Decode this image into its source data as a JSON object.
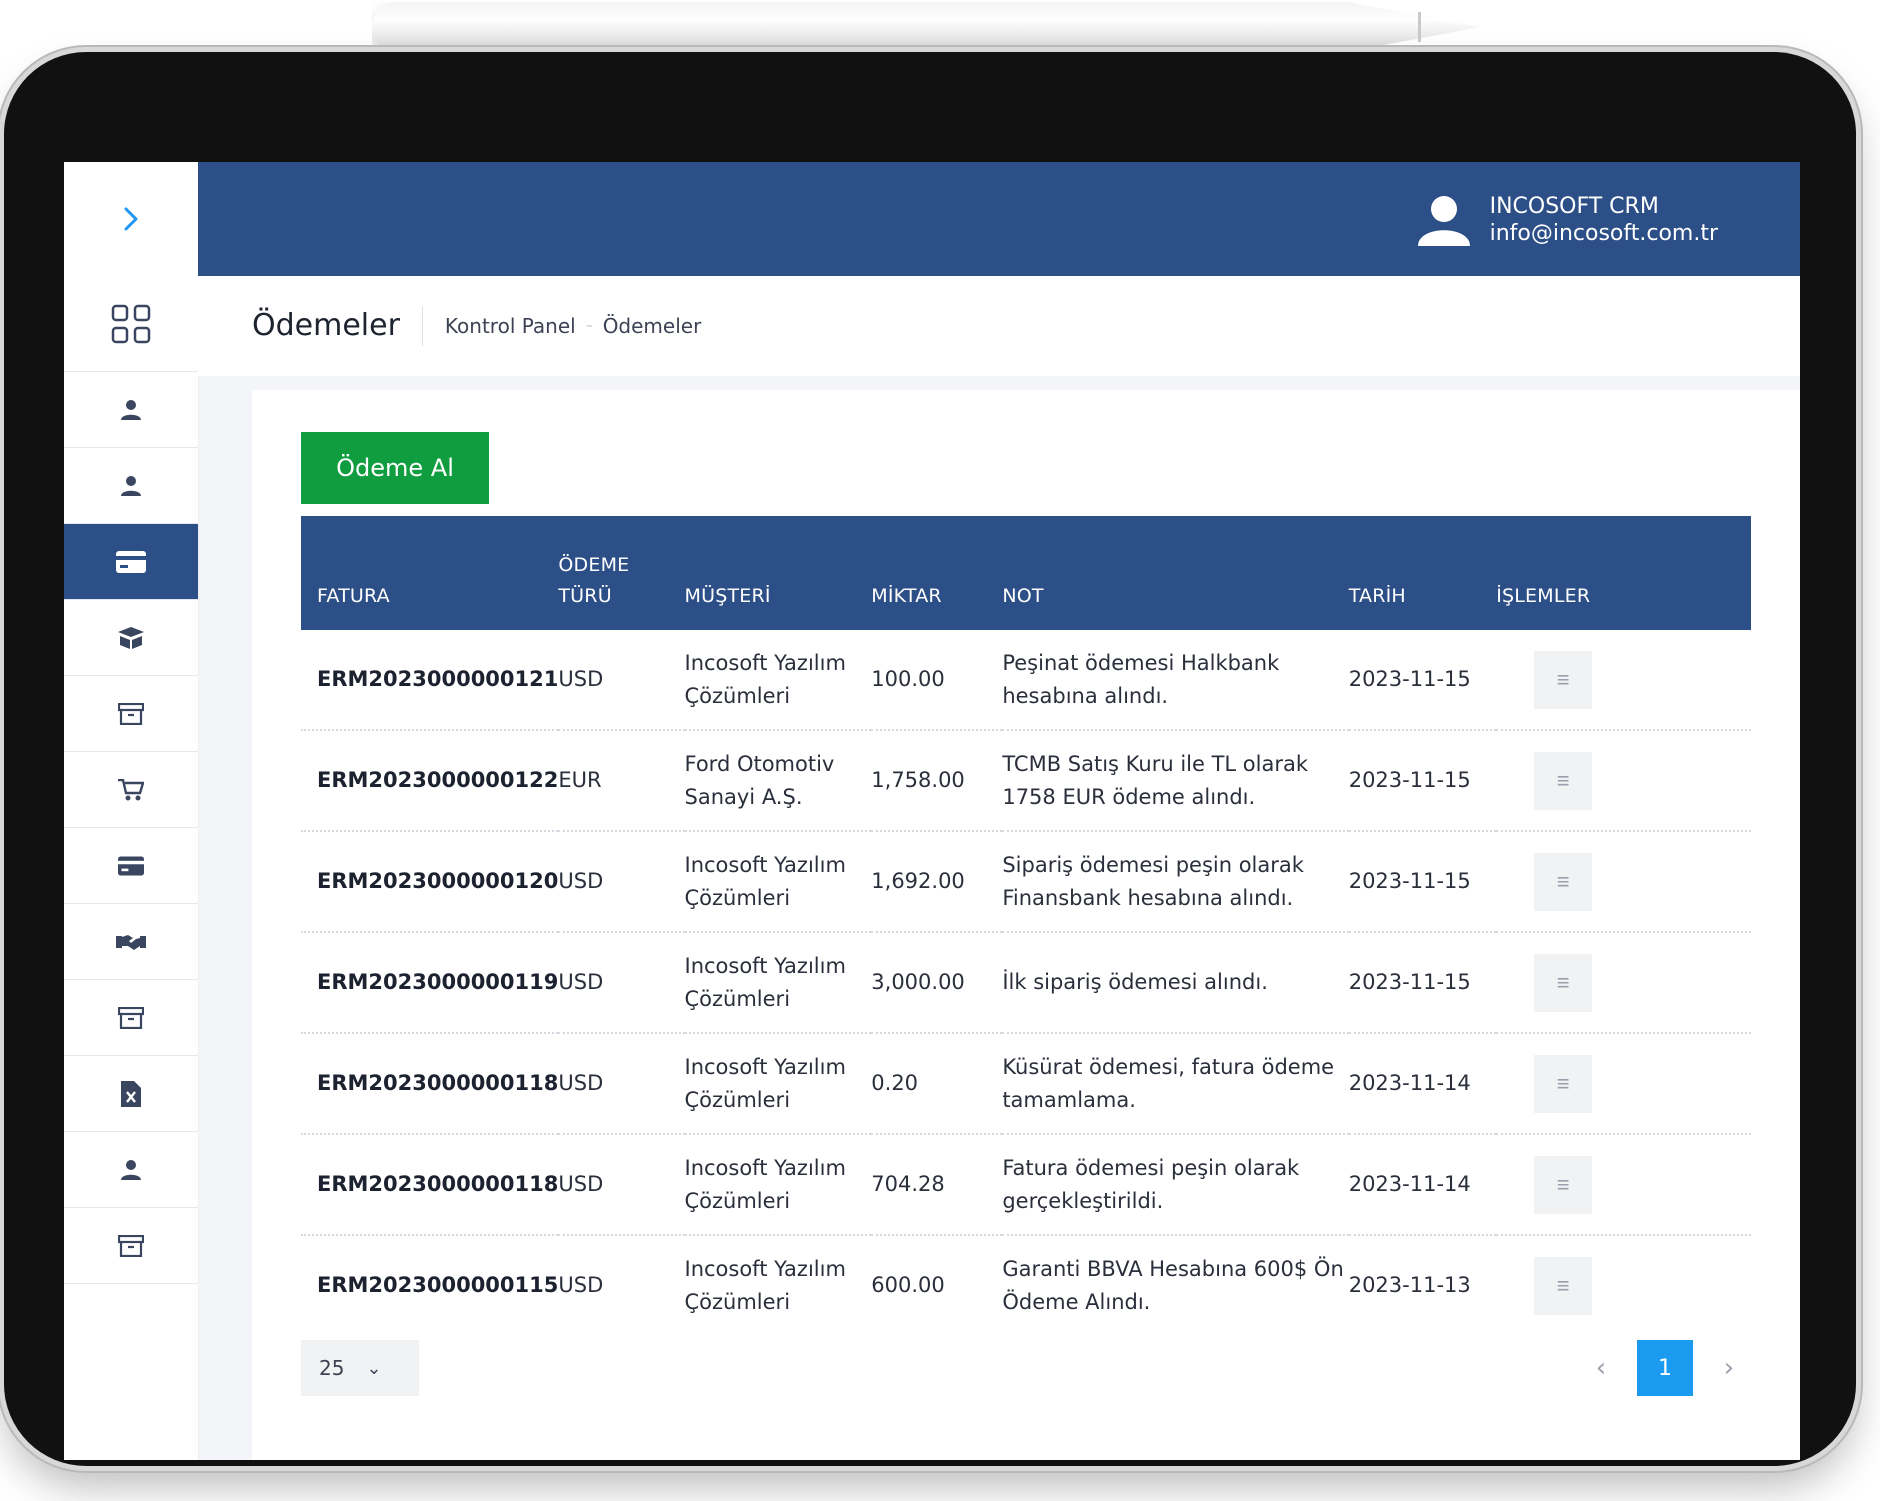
{
  "header": {
    "user_name": "INCOSOFT CRM",
    "user_email": "info@incosoft.com.tr"
  },
  "page": {
    "title": "Ödemeler",
    "breadcrumb": [
      "Kontrol Panel",
      "Ödemeler"
    ]
  },
  "actions": {
    "primary_label": "Ödeme Al"
  },
  "sidebar": {
    "items": [
      {
        "icon": "grid-icon"
      },
      {
        "icon": "user-icon"
      },
      {
        "icon": "user-icon"
      },
      {
        "icon": "credit-card-icon",
        "active": true
      },
      {
        "icon": "box-icon"
      },
      {
        "icon": "archive-icon"
      },
      {
        "icon": "cart-icon"
      },
      {
        "icon": "credit-card-icon"
      },
      {
        "icon": "handshake-icon"
      },
      {
        "icon": "archive-icon"
      },
      {
        "icon": "excel-file-icon"
      },
      {
        "icon": "user-icon"
      },
      {
        "icon": "archive-icon"
      }
    ]
  },
  "table": {
    "headers": {
      "fatura": "FATURA",
      "odeme_turu_1": "ÖDEME",
      "odeme_turu_2": "TÜRÜ",
      "musteri": "MÜŞTERİ",
      "miktar": "MİKTAR",
      "not": "NOT",
      "tarih": "TARİH",
      "islemler": "İŞLEMLER"
    },
    "rows": [
      {
        "fatura": "ERM2023000000121",
        "tur": "USD",
        "musteri": "Incosoft Yazılım Çözümleri",
        "miktar": "100.00",
        "not": "Peşinat ödemesi Halkbank hesabına alındı.",
        "tarih": "2023-11-15"
      },
      {
        "fatura": "ERM2023000000122",
        "tur": "EUR",
        "musteri": "Ford Otomotiv Sanayi A.Ş.",
        "miktar": "1,758.00",
        "not": "TCMB Satış Kuru ile TL olarak 1758 EUR ödeme alındı.",
        "tarih": "2023-11-15"
      },
      {
        "fatura": "ERM2023000000120",
        "tur": "USD",
        "musteri": "Incosoft Yazılım Çözümleri",
        "miktar": "1,692.00",
        "not": "Sipariş ödemesi peşin olarak Finansbank hesabına alındı.",
        "tarih": "2023-11-15"
      },
      {
        "fatura": "ERM2023000000119",
        "tur": "USD",
        "musteri": "Incosoft Yazılım Çözümleri",
        "miktar": "3,000.00",
        "not": "İlk sipariş ödemesi alındı.",
        "tarih": "2023-11-15"
      },
      {
        "fatura": "ERM2023000000118",
        "tur": "USD",
        "musteri": "Incosoft Yazılım Çözümleri",
        "miktar": "0.20",
        "not": "Küsürat ödemesi, fatura ödeme tamamlama.",
        "tarih": "2023-11-14"
      },
      {
        "fatura": "ERM2023000000118",
        "tur": "USD",
        "musteri": "Incosoft Yazılım Çözümleri",
        "miktar": "704.28",
        "not": "Fatura ödemesi peşin olarak gerçekleştirildi.",
        "tarih": "2023-11-14"
      },
      {
        "fatura": "ERM2023000000115",
        "tur": "USD",
        "musteri": "Incosoft Yazılım Çözümleri",
        "miktar": "600.00",
        "not": "Garanti BBVA Hesabına 600$ Ön Ödeme Alındı.",
        "tarih": "2023-11-13"
      }
    ]
  },
  "pagination": {
    "page_size": "25",
    "current_page": "1"
  },
  "colors": {
    "primary": "#2d4f87",
    "success": "#0f9d3f",
    "accent": "#1a9bf0"
  }
}
